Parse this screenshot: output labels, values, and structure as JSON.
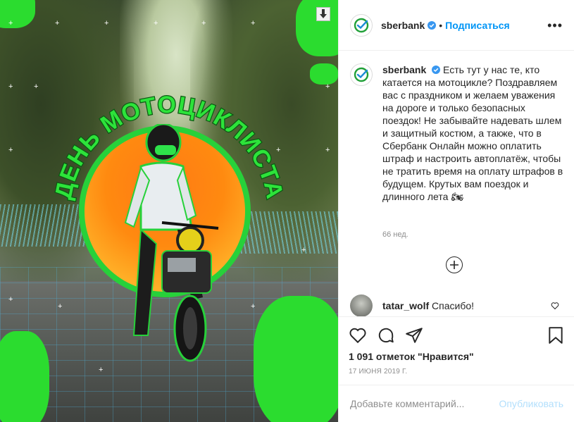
{
  "post": {
    "title_lettering": "ДЕНЬ МОТОЦИКЛИСТА"
  },
  "account": {
    "username": "sberbank",
    "follow_label": "Подписаться",
    "more_label": "•••",
    "separator": "•"
  },
  "caption": {
    "username": "sberbank",
    "text": "Есть тут у нас те, кто катается на мотоцикле? Поздравляем вас с праздником и желаем уважения на дороге и только безопасных поездок! Не забывайте надевать шлем и защитный костюм, а также, что в Сбербанк Онлайн можно оплатить штраф и настроить автоплатёж, чтобы не тратить время на оплату штрафов в будущем. Крутых вам поездок и длинного лета 🏍",
    "time_ago": "66 нед."
  },
  "comments": [
    {
      "username": "tatar_wolf",
      "text": "Спасибо!"
    }
  ],
  "stats": {
    "likes": "1 091 отметок \"Нравится\"",
    "date": "17 ИЮНЯ 2019 Г."
  },
  "add_comment": {
    "placeholder": "Добавьте комментарий...",
    "publish_label": "Опубликовать"
  },
  "icons": {
    "download": "download-icon",
    "verified": "verified-badge-icon",
    "like": "heart-icon",
    "comment": "comment-icon",
    "share": "paper-plane-icon",
    "save": "bookmark-icon",
    "load_more": "plus-circle-icon"
  },
  "colors": {
    "accent_blue": "#0095f6",
    "brand_green": "#21a038",
    "banner_green": "#27d13a",
    "sun_orange": "#ff7a14"
  }
}
